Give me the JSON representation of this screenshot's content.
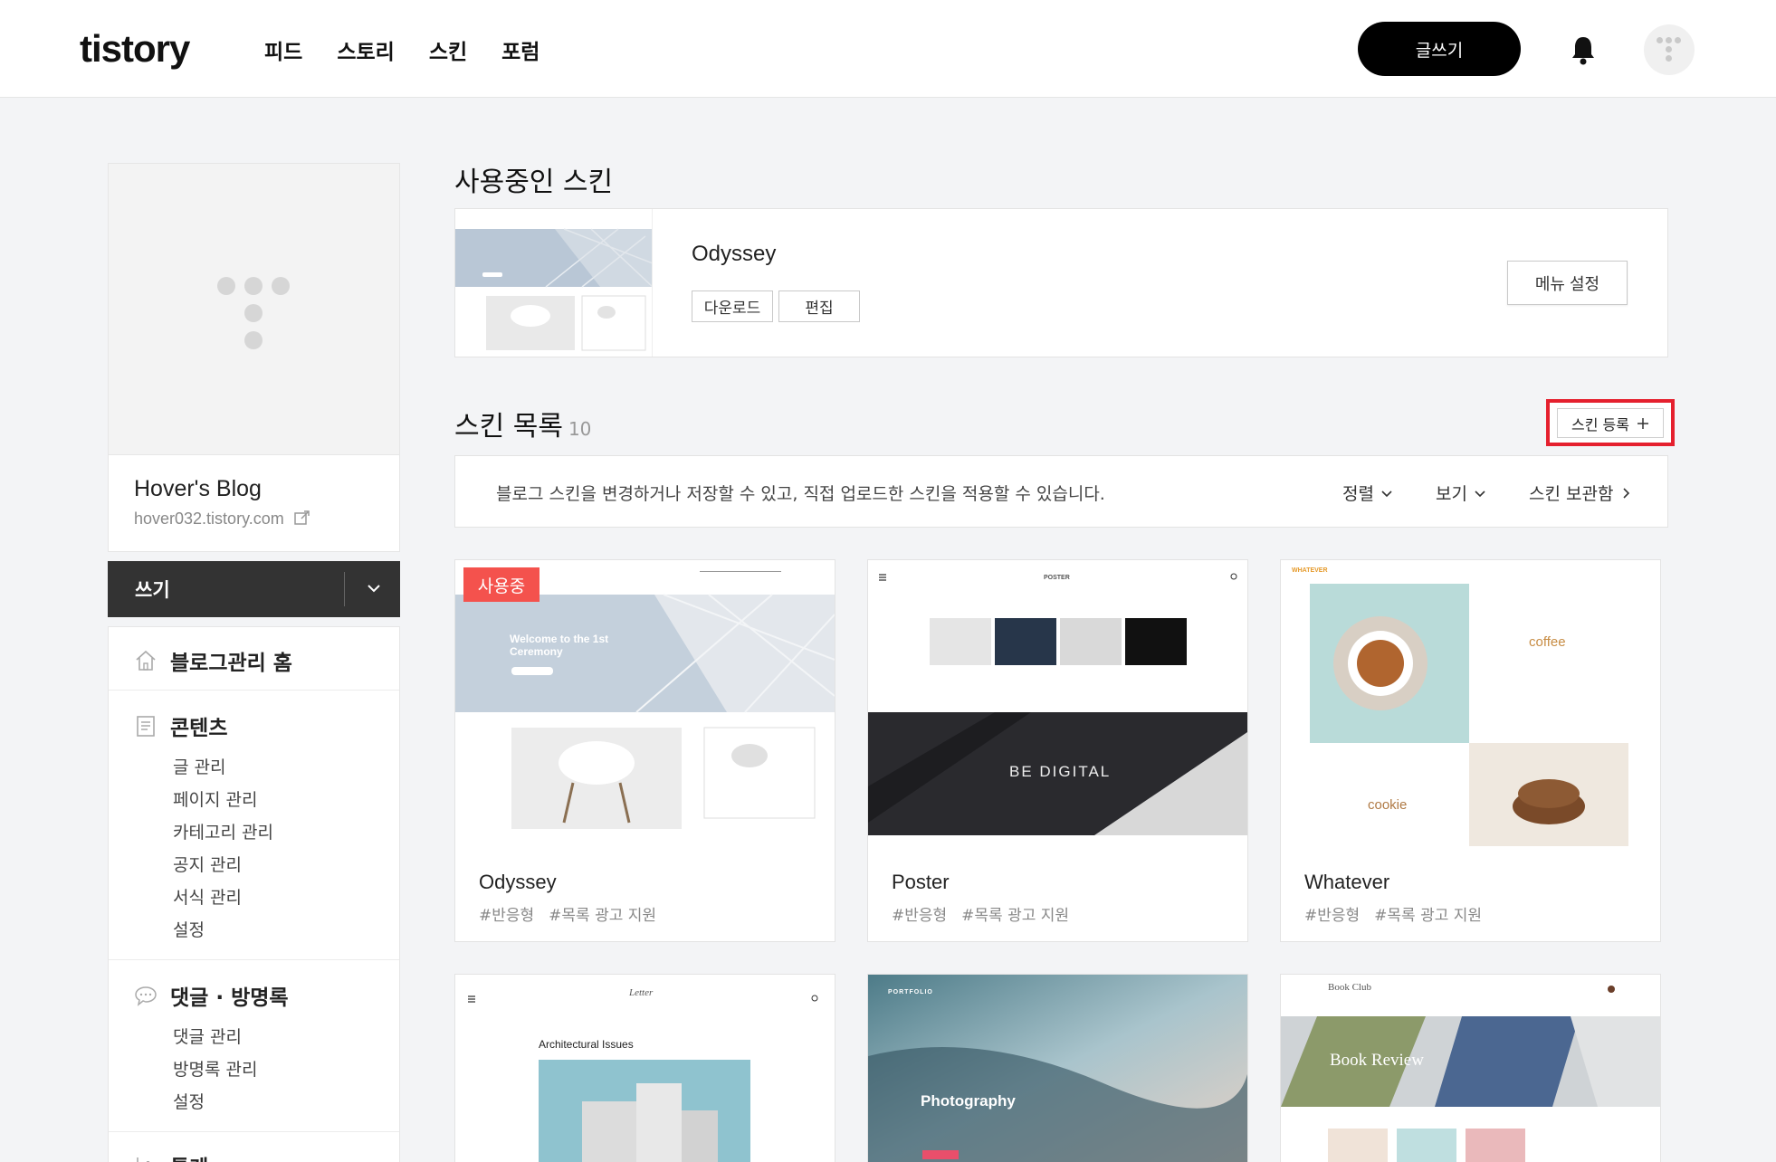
{
  "header": {
    "logo": "tistory",
    "nav": [
      "피드",
      "스토리",
      "스킨",
      "포럼"
    ],
    "write_button": "글쓰기"
  },
  "sidebar": {
    "blog_name": "Hover's Blog",
    "blog_url": "hover032.tistory.com",
    "write_label": "쓰기",
    "home": "블로그관리 홈",
    "contents": {
      "title": "콘텐츠",
      "items": [
        "글 관리",
        "페이지 관리",
        "카테고리 관리",
        "공지 관리",
        "서식 관리",
        "설정"
      ]
    },
    "comments": {
      "title": "댓글 · 방명록",
      "items": [
        "댓글 관리",
        "방명록 관리",
        "설정"
      ]
    },
    "stats_title": "통계"
  },
  "current_skin": {
    "section_title": "사용중인 스킨",
    "name": "Odyssey",
    "download": "다운로드",
    "edit": "편집",
    "menu_settings": "메뉴 설정"
  },
  "skin_list": {
    "section_title": "스킨 목록",
    "count": "10",
    "register": "스킨 등록",
    "description": "블로그 스킨을 변경하거나 저장할 수 있고, 직접 업로드한 스킨을 적용할 수 있습니다.",
    "sort": "정렬",
    "view": "보기",
    "storage": "스킨 보관함",
    "in_use_badge": "사용중",
    "skins": [
      {
        "name": "Odyssey",
        "tags": [
          "#반응형",
          "#목록 광고 지원"
        ]
      },
      {
        "name": "Poster",
        "tags": [
          "#반응형",
          "#목록 광고 지원"
        ]
      },
      {
        "name": "Whatever",
        "tags": [
          "#반응형",
          "#목록 광고 지원"
        ]
      }
    ],
    "thumb_text": {
      "odyssey_welcome": "Welcome to the 1st Ceremony",
      "poster_brand": "POSTER",
      "poster_hero": "BE DIGITAL",
      "whatever_brand": "WHATEVER",
      "whatever_coffee": "coffee",
      "whatever_cookie": "cookie",
      "letter_brand": "Letter",
      "letter_heading": "Architectural Issues",
      "portfolio_brand": "PORTFOLIO",
      "portfolio_hero": "Photography",
      "bookclub_brand": "Book Club",
      "bookclub_hero": "Book Review"
    }
  }
}
